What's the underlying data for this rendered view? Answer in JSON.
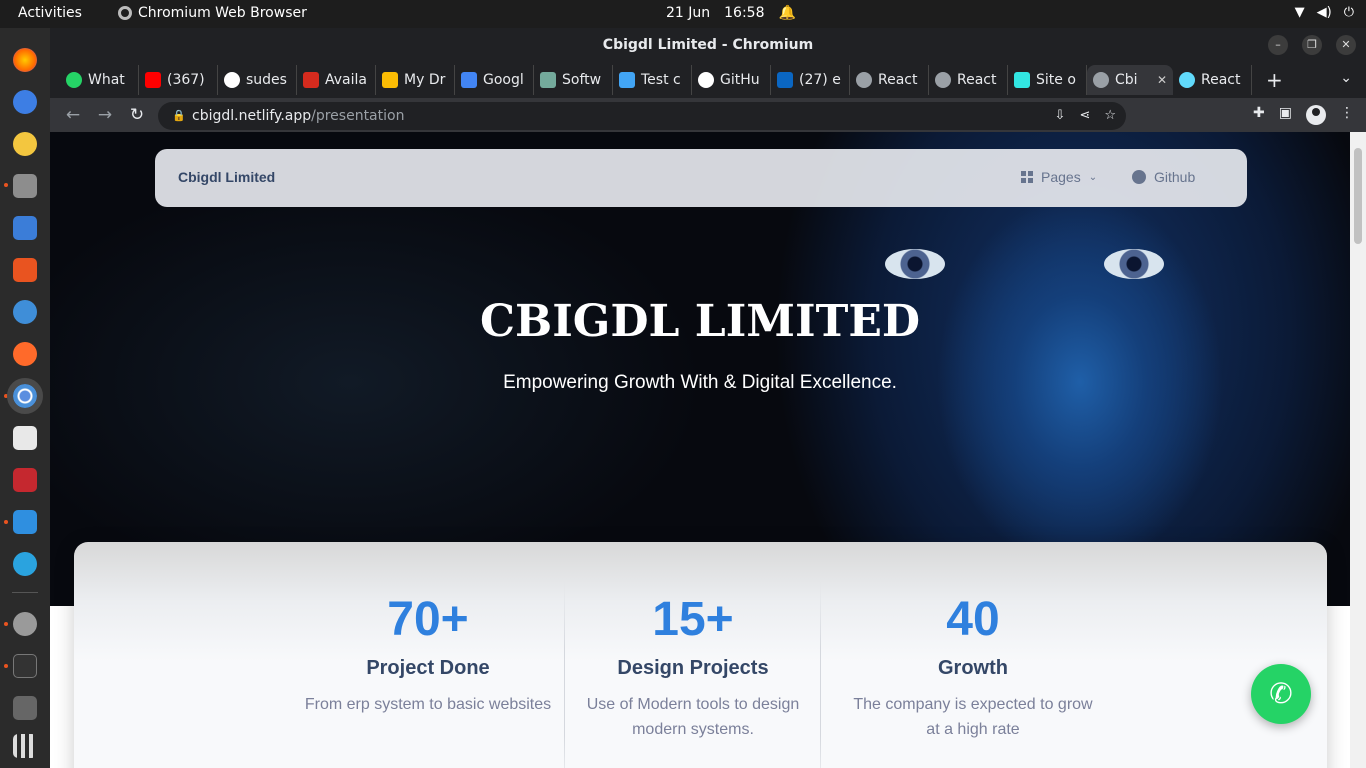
{
  "topbar": {
    "activities": "Activities",
    "app_name": "Chromium Web Browser",
    "date": "21 Jun",
    "time": "16:58"
  },
  "window": {
    "title": "Cbigdl Limited - Chromium"
  },
  "tabs": [
    {
      "label": "What",
      "icon": "whatsapp-icon",
      "color": "#25d366"
    },
    {
      "label": "(367)",
      "icon": "youtube-icon",
      "color": "#ff0000"
    },
    {
      "label": "sudes",
      "icon": "github-icon",
      "color": "#ffffff"
    },
    {
      "label": "Availa",
      "icon": "maple-leaf-icon",
      "color": "#d52b1e"
    },
    {
      "label": "My Dr",
      "icon": "drive-icon",
      "color": "#fbbc04"
    },
    {
      "label": "Googl",
      "icon": "google-icon",
      "color": "#4285f4"
    },
    {
      "label": "Softw",
      "icon": "chatgpt-icon",
      "color": "#74aa9c"
    },
    {
      "label": "Test c",
      "icon": "flutter-icon",
      "color": "#42a5f5"
    },
    {
      "label": "GitHu",
      "icon": "github-icon",
      "color": "#ffffff"
    },
    {
      "label": "(27) e",
      "icon": "linkedin-icon",
      "color": "#0a66c2"
    },
    {
      "label": "React",
      "icon": "globe-icon",
      "color": "#9aa0a6"
    },
    {
      "label": "React",
      "icon": "globe-icon",
      "color": "#9aa0a6"
    },
    {
      "label": "Site o",
      "icon": "netlify-icon",
      "color": "#32e6e2"
    },
    {
      "label": "Cbi",
      "icon": "globe-icon",
      "color": "#9aa0a6",
      "active": true
    },
    {
      "label": "React",
      "icon": "react-icon",
      "color": "#61dafb"
    }
  ],
  "address": {
    "host": "cbigdl.netlify.app",
    "path": "/presentation"
  },
  "site": {
    "brand": "Cbigdl Limited",
    "nav_pages": "Pages",
    "nav_github": "Github",
    "hero_title": "CBIGDL LIMITED",
    "hero_subtitle": "Empowering Growth With & Digital Excellence.",
    "stats": [
      {
        "number": "70+",
        "label": "Project Done",
        "desc1": "From erp system to basic websites",
        "desc2": ""
      },
      {
        "number": "15+",
        "label": "Design Projects",
        "desc1": "Use of Modern tools to design",
        "desc2": "modern systems."
      },
      {
        "number": "40",
        "label": "Growth",
        "desc1": "The company is expected to grow",
        "desc2": "at a high rate"
      }
    ]
  },
  "colors": {
    "accent_blue": "#2f80de",
    "heading": "#344767",
    "whatsapp_green": "#25d366"
  }
}
